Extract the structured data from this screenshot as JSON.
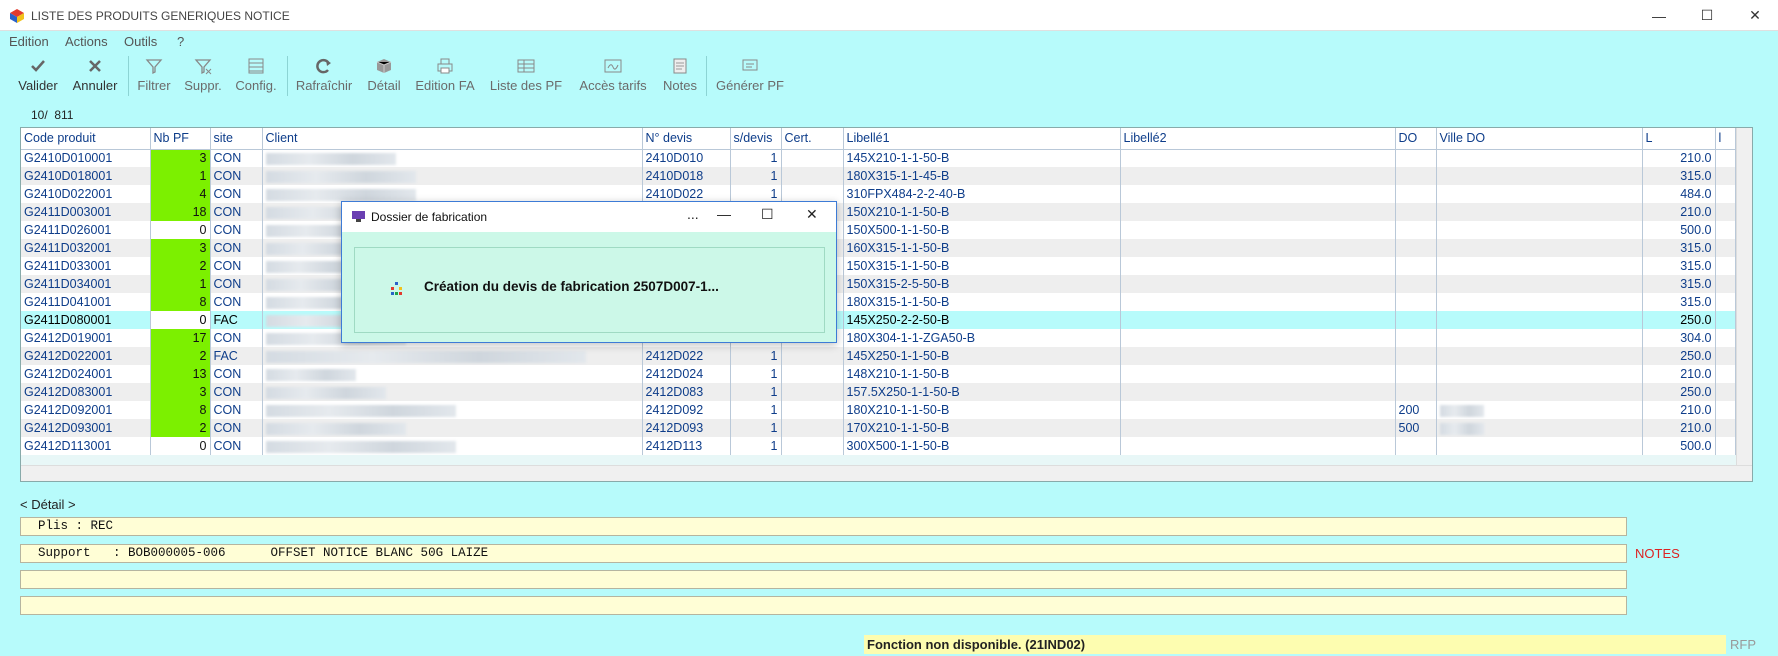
{
  "window": {
    "title": "LISTE DES PRODUITS GENERIQUES NOTICE"
  },
  "menu": [
    "Edition",
    "Actions",
    "Outils",
    "?"
  ],
  "toolbar": [
    {
      "label": "Valider",
      "icon": "check-icon"
    },
    {
      "label": "Annuler",
      "icon": "x-icon"
    },
    {
      "label": "Filtrer",
      "icon": "funnel-icon"
    },
    {
      "label": "Suppr.",
      "icon": "funnel-delete-icon"
    },
    {
      "label": "Config.",
      "icon": "table-config-icon"
    },
    {
      "label": "Rafraîchir",
      "icon": "refresh-icon"
    },
    {
      "label": "Détail",
      "icon": "box-icon"
    },
    {
      "label": "Edition FA",
      "icon": "printer-icon"
    },
    {
      "label": "Liste des PF",
      "icon": "list-icon"
    },
    {
      "label": "Accès tarifs",
      "icon": "signature-icon"
    },
    {
      "label": "Notes",
      "icon": "notes-icon"
    },
    {
      "label": "Générer PF",
      "icon": "generate-icon"
    }
  ],
  "record_count": "10/  811",
  "grid": {
    "columns": [
      "Code produit",
      "Nb PF",
      "site",
      "Client",
      "N° devis",
      "s/devis",
      "Cert.",
      "Libellé1",
      "Libellé2",
      "DO",
      "Ville DO",
      "L",
      "l"
    ],
    "rows": [
      {
        "code": "G2410D010001",
        "nbpf": "3",
        "site": "CON",
        "devis": "2410D010",
        "sdevis": "1",
        "lib1": "145X210-1-1-50-B",
        "do": "",
        "L": "210.0"
      },
      {
        "code": "G2410D018001",
        "nbpf": "1",
        "site": "CON",
        "devis": "2410D018",
        "sdevis": "1",
        "lib1": "180X315-1-1-45-B",
        "do": "",
        "L": "315.0"
      },
      {
        "code": "G2410D022001",
        "nbpf": "4",
        "site": "CON",
        "devis": "2410D022",
        "sdevis": "1",
        "lib1": "310FPX484-2-2-40-B",
        "do": "",
        "L": "484.0"
      },
      {
        "code": "G2411D003001",
        "nbpf": "18",
        "site": "CON",
        "devis": "",
        "sdevis": "",
        "lib1": "150X210-1-1-50-B",
        "do": "",
        "L": "210.0"
      },
      {
        "code": "G2411D026001",
        "nbpf": "0",
        "site": "CON",
        "devis": "",
        "sdevis": "",
        "lib1": "150X500-1-1-50-B",
        "do": "",
        "L": "500.0"
      },
      {
        "code": "G2411D032001",
        "nbpf": "3",
        "site": "CON",
        "devis": "",
        "sdevis": "",
        "lib1": "160X315-1-1-50-B",
        "do": "",
        "L": "315.0"
      },
      {
        "code": "G2411D033001",
        "nbpf": "2",
        "site": "CON",
        "devis": "",
        "sdevis": "",
        "lib1": "150X315-1-1-50-B",
        "do": "",
        "L": "315.0"
      },
      {
        "code": "G2411D034001",
        "nbpf": "1",
        "site": "CON",
        "devis": "",
        "sdevis": "",
        "lib1": "150X315-2-5-50-B",
        "do": "",
        "L": "315.0"
      },
      {
        "code": "G2411D041001",
        "nbpf": "8",
        "site": "CON",
        "devis": "",
        "sdevis": "",
        "lib1": "180X315-1-1-50-B",
        "do": "",
        "L": "315.0"
      },
      {
        "code": "G2411D080001",
        "nbpf": "0",
        "site": "FAC",
        "devis": "",
        "sdevis": "",
        "lib1": "145X250-2-2-50-B",
        "do": "",
        "L": "250.0",
        "selected": true
      },
      {
        "code": "G2412D019001",
        "nbpf": "17",
        "site": "CON",
        "devis": "",
        "sdevis": "",
        "lib1": "180X304-1-1-ZGA50-B",
        "do": "",
        "L": "304.0"
      },
      {
        "code": "G2412D022001",
        "nbpf": "2",
        "site": "FAC",
        "devis": "2412D022",
        "sdevis": "1",
        "lib1": "145X250-1-1-50-B",
        "do": "",
        "L": "250.0"
      },
      {
        "code": "G2412D024001",
        "nbpf": "13",
        "site": "CON",
        "devis": "2412D024",
        "sdevis": "1",
        "lib1": "148X210-1-1-50-B",
        "do": "",
        "L": "210.0"
      },
      {
        "code": "G2412D083001",
        "nbpf": "3",
        "site": "CON",
        "devis": "2412D083",
        "sdevis": "1",
        "lib1": "157.5X250-1-1-50-B",
        "do": "",
        "L": "250.0"
      },
      {
        "code": "G2412D092001",
        "nbpf": "8",
        "site": "CON",
        "devis": "2412D092",
        "sdevis": "1",
        "lib1": "180X210-1-1-50-B",
        "do": "200",
        "L": "210.0"
      },
      {
        "code": "G2412D093001",
        "nbpf": "2",
        "site": "CON",
        "devis": "2412D093",
        "sdevis": "1",
        "lib1": "170X210-1-1-50-B",
        "do": "500",
        "L": "210.0"
      },
      {
        "code": "G2412D113001",
        "nbpf": "0",
        "site": "CON",
        "devis": "2412D113",
        "sdevis": "1",
        "lib1": "300X500-1-1-50-B",
        "do": "",
        "L": "500.0"
      }
    ]
  },
  "detail": {
    "label": "< Détail >",
    "lines": [
      "Plis : REC",
      "Support   : BOB000005-006      OFFSET NOTICE BLANC 50G LAIZE",
      "",
      ""
    ],
    "notes": "NOTES"
  },
  "status": {
    "message": "Fonction non disponible. (21IND02)",
    "code": "RFP"
  },
  "dialog": {
    "title": "Dossier de fabrication",
    "dots": "...",
    "message": "Création du devis de fabrication 2507D007-1..."
  }
}
